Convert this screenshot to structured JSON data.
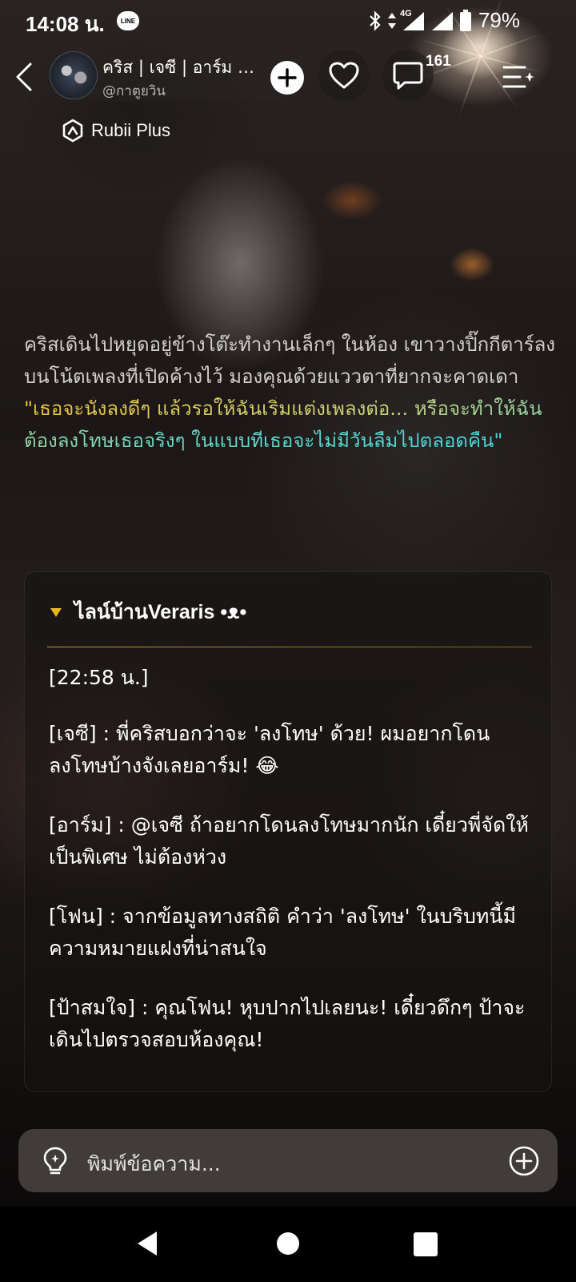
{
  "status_bar": {
    "time": "14:08 น.",
    "line_badge": "LINE",
    "network": "4G",
    "battery": "79%"
  },
  "header": {
    "character_name": "คริส | เจซี | อาร์ม | โฟน | ป้าสมใจ",
    "creator_handle": "@กาตูยวิน",
    "comment_count": "161",
    "plus_label": "Rubii Plus"
  },
  "narrative": {
    "action": "คริสเดินไปหยุดอยู่ข้างโต๊ะทำงานเล็กๆ ในห้อง เขาวางปิ๊กกีตาร์ลงบนโน้ตเพลงที่เปิดค้างไว้ มองคุณด้วยแววตาที่ยากจะคาดเดา",
    "speech": "\"เธอจะนั่งลงดีๆ แล้วรอให้ฉันเริ่มแต่งเพลงต่อ... หรือจะทำให้ฉันต้องลงโทษเธอจริงๆ ในแบบที่เธอจะไม่มีวันลืมไปตลอดคืน\""
  },
  "group_chat": {
    "title": "ไลน์บ้านVeraris •ᴥ•",
    "timestamp": "[22:58 น.]",
    "messages": [
      "[เจซี] : พี่คริสบอกว่าจะ 'ลงโทษ' ด้วย! ผมอยากโดนลงโทษบ้างจังเลยอาร์ม! 😂",
      "[อาร์ม] : @เจซี ถ้าอยากโดนลงโทษมากนัก เดี๋ยวพี่จัดให้เป็นพิเศษ ไม่ต้องห่วง",
      "[โฟน] : จากข้อมูลทางสถิติ คำว่า 'ลงโทษ' ในบริบทนี้มีความหมายแฝงที่น่าสนใจ",
      "[ป้าสมใจ] : คุณโฟน! หุบปากไปเลยนะ! เดี๋ยวดึกๆ ป้าจะเดินไปตรวจสอบห้องคุณ!"
    ]
  },
  "input": {
    "placeholder": "พิมพ์ข้อความ..."
  },
  "colors": {
    "accent_gold": "#e8b91c",
    "speech_gradient_start": "#e9c341",
    "speech_gradient_end": "#46d5d8"
  }
}
